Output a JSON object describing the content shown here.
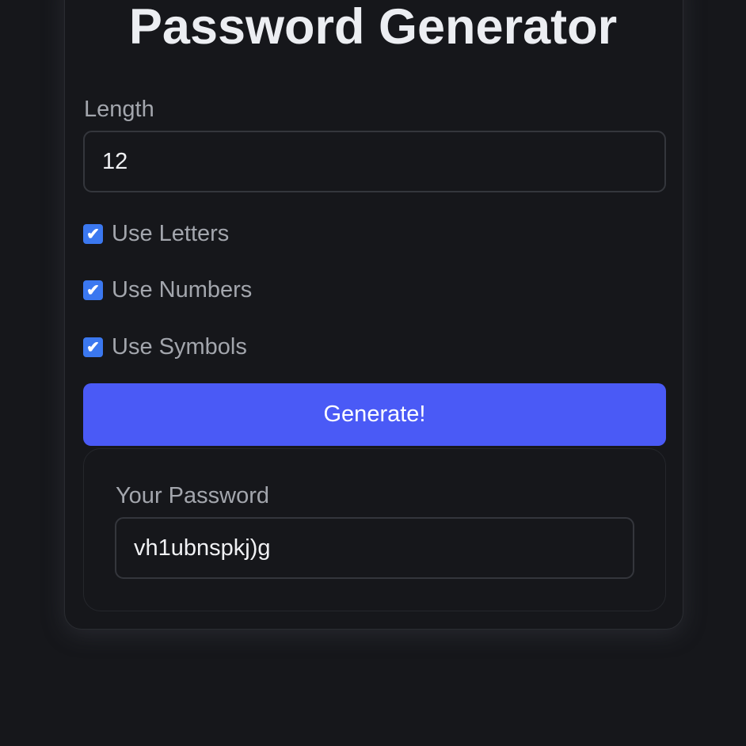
{
  "title": "Password Generator",
  "length": {
    "label": "Length",
    "value": "12"
  },
  "options": [
    {
      "label": "Use Letters",
      "checked": true
    },
    {
      "label": "Use Numbers",
      "checked": true
    },
    {
      "label": "Use Symbols",
      "checked": true
    }
  ],
  "generate_label": "Generate!",
  "result": {
    "label": "Your Password",
    "value": "vh1ubnspkj)g"
  },
  "colors": {
    "accent": "#4a5af6",
    "checkbox": "#3b78f0",
    "background": "#16171b"
  }
}
